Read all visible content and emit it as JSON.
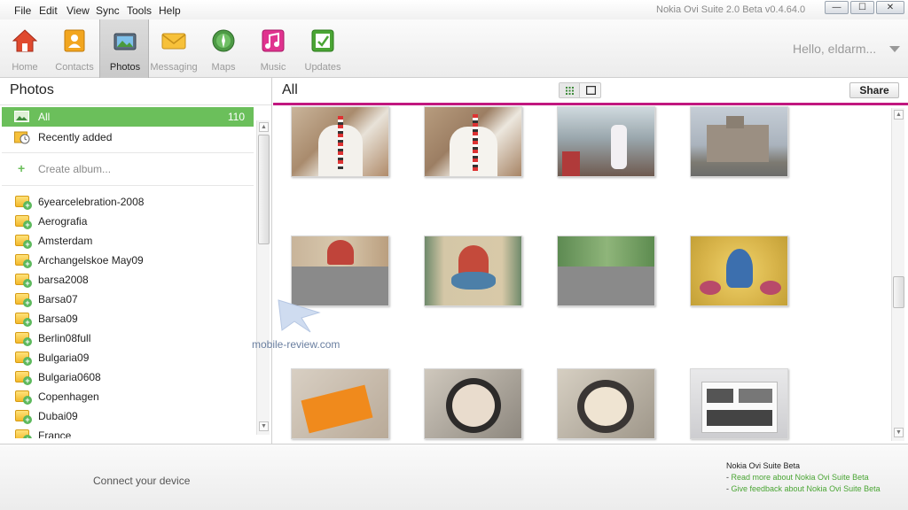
{
  "menu": [
    "File",
    "Edit",
    "View",
    "Sync",
    "Tools",
    "Help"
  ],
  "app_title": "Nokia Ovi Suite 2.0 Beta v0.4.64.0",
  "window_controls": {
    "minimize": "—",
    "maximize": "☐",
    "close": "✕"
  },
  "toolbar": {
    "items": [
      {
        "label": "Home",
        "icon": "home-icon",
        "color": "#d9412b"
      },
      {
        "label": "Contacts",
        "icon": "contacts-icon",
        "color": "#f0a21c"
      },
      {
        "label": "Photos",
        "icon": "photos-icon",
        "color": "#3b8fc9",
        "active": true
      },
      {
        "label": "Messaging",
        "icon": "messaging-icon",
        "color": "#f2b52a"
      },
      {
        "label": "Maps",
        "icon": "maps-icon",
        "color": "#3e8b3a"
      },
      {
        "label": "Music",
        "icon": "music-icon",
        "color": "#e0338f"
      },
      {
        "label": "Updates",
        "icon": "updates-icon",
        "color": "#4aa534"
      }
    ],
    "greeting": "Hello, eldarm..."
  },
  "left": {
    "title": "Photos",
    "all": {
      "label": "All",
      "count": "110"
    },
    "recently_added": "Recently added",
    "create_album": "Create album...",
    "albums": [
      "6yearcelebration-2008",
      "Aerografia",
      "Amsterdam",
      "Archangelskoe May09",
      "barsa2008",
      "Barsa07",
      "Barsa09",
      "Berlin08full",
      "Bulgaria09",
      "Bulgaria0608",
      "Copenhagen",
      "Dubai09",
      "France"
    ]
  },
  "right": {
    "title": "All",
    "share_label": "Share"
  },
  "watermark": "mobile-review.com",
  "footer": {
    "connect": "Connect your device",
    "title": "Nokia Ovi Suite Beta",
    "link1": "Read more about Nokia Ovi Suite Beta",
    "link2": "Give feedback about Nokia Ovi Suite Beta"
  },
  "colors": {
    "accent": "#6bbf5b",
    "divider": "#c1177f"
  }
}
